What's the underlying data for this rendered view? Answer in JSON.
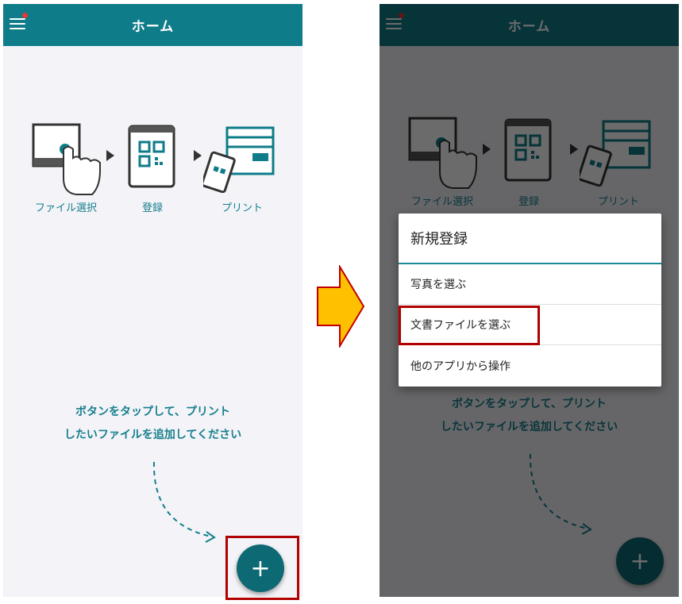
{
  "app": {
    "title": "ホーム",
    "steps": [
      {
        "label": "ファイル選択"
      },
      {
        "label": "登録"
      },
      {
        "label": "プリント"
      }
    ],
    "hint_line1": "ボタンをタップして、プリント",
    "hint_line2": "したいファイルを追加してください",
    "fab_label": "+"
  },
  "dialog": {
    "title": "新規登録",
    "items": [
      {
        "label": "写真を選ぶ"
      },
      {
        "label": "文書ファイルを選ぶ"
      },
      {
        "label": "他のアプリから操作"
      }
    ]
  },
  "colors": {
    "appbar": "#0f7c89",
    "accent": "#167f8c",
    "fab": "#0d6a74",
    "highlight": "#b00000",
    "arrow_fill": "#ffc000",
    "arrow_stroke": "#c00000"
  },
  "icons": [
    "menu-icon",
    "tablet-tap-icon",
    "qr-phone-icon",
    "printer-icon",
    "plus-icon"
  ]
}
